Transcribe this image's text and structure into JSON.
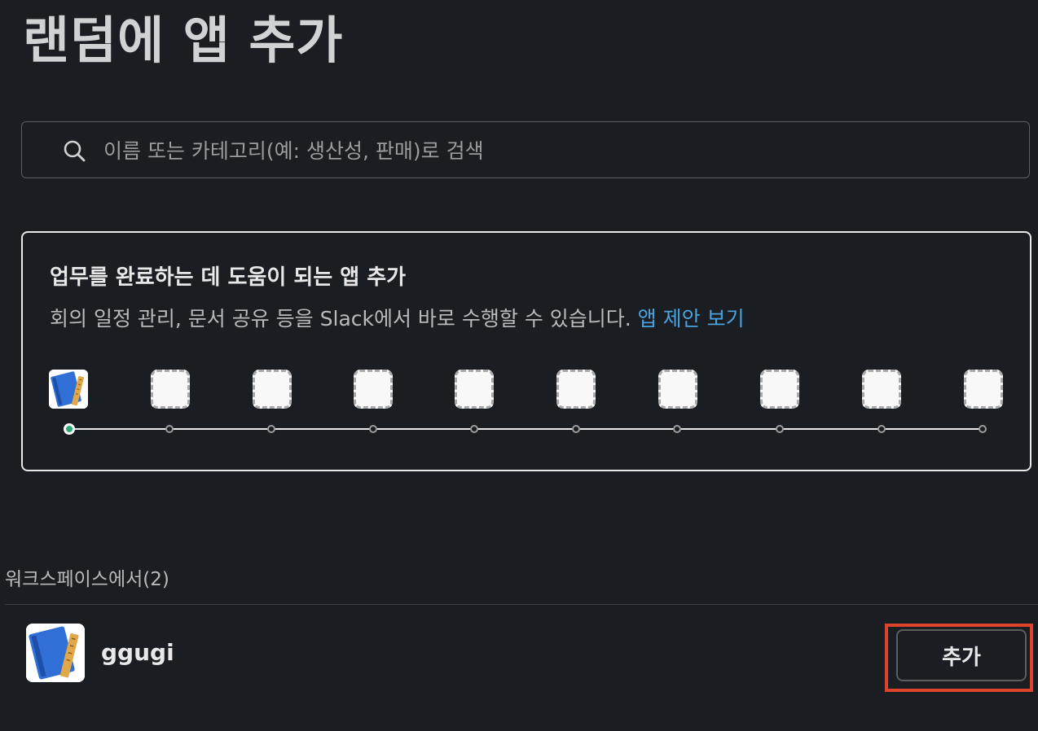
{
  "page": {
    "title": "랜덤에 앱 추가"
  },
  "search": {
    "placeholder": "이름 또는 카테고리(예: 생산성, 판매)로 검색",
    "value": ""
  },
  "onboarding": {
    "heading": "업무를 완료하는 데 도움이 되는 앱 추가",
    "description": "회의 일정 관리, 문서 공유 등을 Slack에서 바로 수행할 수 있습니다. ",
    "link_label": "앱 제안 보기",
    "slots_total": 10,
    "slots_filled": 1,
    "accent_color": "#2bac76"
  },
  "workspace": {
    "section_label": "워크스페이스에서(2)",
    "apps": [
      {
        "name": "ggugi",
        "icon": "blueprint-notebook-icon",
        "action_label": "추가"
      }
    ]
  },
  "colors": {
    "background": "#1a1d21",
    "link": "#4aa3df",
    "highlight": "#e0432b"
  }
}
